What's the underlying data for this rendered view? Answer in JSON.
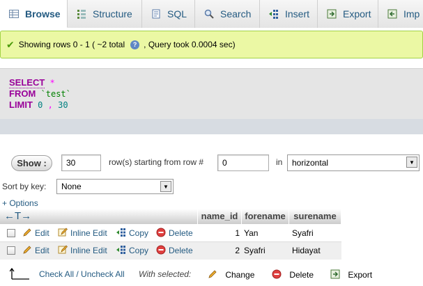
{
  "tabs": [
    {
      "label": "Browse",
      "icon": "browse-icon",
      "active": true
    },
    {
      "label": "Structure",
      "icon": "structure-icon"
    },
    {
      "label": "SQL",
      "icon": "sql-icon"
    },
    {
      "label": "Search",
      "icon": "search-icon"
    },
    {
      "label": "Insert",
      "icon": "insert-icon"
    },
    {
      "label": "Export",
      "icon": "export-icon"
    },
    {
      "label": "Imp",
      "icon": "import-icon"
    }
  ],
  "status": {
    "text_before": "Showing rows 0 - 1 ( ~2 total",
    "help_glyph": "?",
    "text_after": ", Query took 0.0004 sec)"
  },
  "sql": {
    "select_kw": "SELECT",
    "star": "*",
    "from_kw": "FROM",
    "table": "`test`",
    "limit_kw": "LIMIT",
    "offset": "0",
    "comma": ",",
    "count": "30"
  },
  "controls": {
    "show_button": "Show :",
    "rows_value": "30",
    "rows_label": "row(s) starting from row #",
    "start_value": "0",
    "in_label": "in",
    "mode_value": "horizontal",
    "sort_label": "Sort by key:",
    "sort_value": "None",
    "options_link": "+ Options"
  },
  "table": {
    "nav_arrows": "←T→",
    "columns": [
      "name_id",
      "forename",
      "surename"
    ],
    "actions": {
      "edit": "Edit",
      "inline_edit": "Inline Edit",
      "copy": "Copy",
      "delete": "Delete"
    },
    "rows": [
      {
        "name_id": "1",
        "forename": "Yan",
        "surename": "Syafri"
      },
      {
        "name_id": "2",
        "forename": "Syafri",
        "surename": "Hidayat"
      }
    ]
  },
  "bottom": {
    "check_all": "Check All / Uncheck All",
    "with_selected": "With selected:",
    "change": "Change",
    "delete": "Delete",
    "export": "Export"
  },
  "colors": {
    "link": "#235a81",
    "success_bg": "#ebf8a4",
    "keyword": "#990099"
  }
}
